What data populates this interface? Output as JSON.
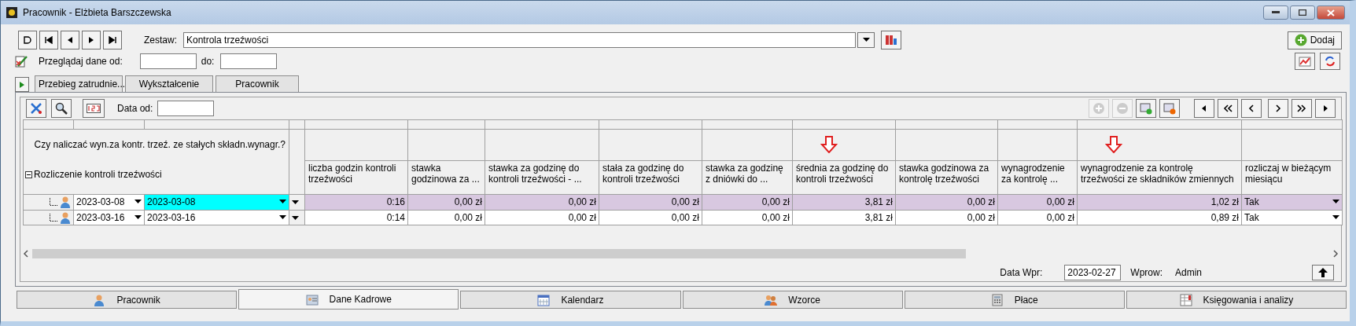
{
  "window": {
    "title": "Pracownik - Elżbieta Barszczewska"
  },
  "zestaw": {
    "label": "Zestaw:",
    "value": "Kontrola trzeźwości"
  },
  "filter": {
    "label": "Przeglądaj dane od:",
    "to_label": "do:"
  },
  "add_button": {
    "label": "Dodaj"
  },
  "tabs": [
    {
      "label": "Przebieg zatrudnie...",
      "selected": false
    },
    {
      "label": "Wykształcenie",
      "selected": false
    },
    {
      "label": "Pracownik",
      "selected": false
    }
  ],
  "grid_toolbar": {
    "date_label": "Data od:"
  },
  "grid": {
    "group_label": "Czy naliczać wyn.za kontr. trzeź. ze stałych składn.wynagr.?",
    "tree_label": "Rozliczenie kontroli trzeźwości",
    "expanded": true,
    "columns": [
      {
        "label": "liczba godzin kontroli trzeźwości",
        "arrow": false
      },
      {
        "label": "stawka godzinowa za ...",
        "arrow": false
      },
      {
        "label": "stawka za godzinę do kontroli trzeźwości - ...",
        "arrow": false
      },
      {
        "label": "stała za godzinę do kontroli trzeźwości",
        "arrow": false
      },
      {
        "label": "stawka za godzinę z dniówki do ...",
        "arrow": false
      },
      {
        "label": "średnia za godzinę do kontroli trzeźwości",
        "arrow": true
      },
      {
        "label": "stawka godzinowa za kontrolę trzeźwości",
        "arrow": false
      },
      {
        "label": "wynagrodzenie za kontrolę ...",
        "arrow": false
      },
      {
        "label": "wynagrodzenie za kontrolę trzeźwości ze składników zmiennych",
        "arrow": true
      },
      {
        "label": "rozliczaj w bieżącym miesiącu",
        "arrow": false
      }
    ],
    "rows": [
      {
        "selected": true,
        "date_from": "2023-03-08",
        "date_to": "2023-03-08",
        "cells": [
          "0:16",
          "0,00 zł",
          "0,00 zł",
          "0,00 zł",
          "0,00 zł",
          "3,81 zł",
          "0,00 zł",
          "0,00 zł",
          "1,02 zł",
          "Tak"
        ]
      },
      {
        "selected": false,
        "date_from": "2023-03-16",
        "date_to": "2023-03-16",
        "cells": [
          "0:14",
          "0,00 zł",
          "0,00 zł",
          "0,00 zł",
          "0,00 zł",
          "3,81 zł",
          "0,00 zł",
          "0,00 zł",
          "0,89 zł",
          "Tak"
        ]
      }
    ]
  },
  "data_wpr": {
    "label": "Data Wpr:",
    "value": "2023-02-27"
  },
  "wprow": {
    "label": "Wprow:",
    "value": "Admin"
  },
  "bottom_tabs": [
    {
      "label": "Pracownik",
      "selected": false
    },
    {
      "label": "Dane Kadrowe",
      "selected": true
    },
    {
      "label": "Kalendarz",
      "selected": false
    },
    {
      "label": "Wzorce",
      "selected": false
    },
    {
      "label": "Płace",
      "selected": false
    },
    {
      "label": "Księgowania i analizy",
      "selected": false
    }
  ]
}
